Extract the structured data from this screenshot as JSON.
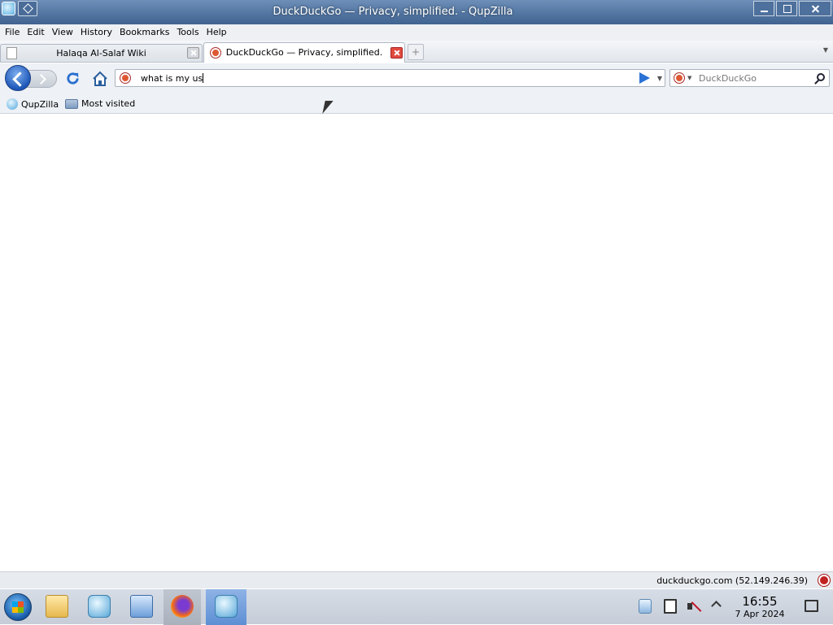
{
  "window": {
    "title": "DuckDuckGo — Privacy, simplified. - QupZilla"
  },
  "menubar": {
    "items": [
      "File",
      "Edit",
      "View",
      "History",
      "Bookmarks",
      "Tools",
      "Help"
    ]
  },
  "tabs": [
    {
      "label": "Halaqa Al-Salaf Wiki",
      "active": false
    },
    {
      "label": "DuckDuckGo — Privacy, simplified.",
      "active": true
    }
  ],
  "navbar": {
    "url_value": "what is my us",
    "search_placeholder": "DuckDuckGo"
  },
  "bookmarks": {
    "items": [
      "QupZilla",
      "Most visited"
    ]
  },
  "statusbar": {
    "text": "duckduckgo.com (52.149.246.39)"
  },
  "taskbar": {
    "apps": [
      "file-manager",
      "qupzilla",
      "system-settings",
      "firefox",
      "qupzilla-active"
    ],
    "clock": {
      "time": "16:55",
      "date": "7 Apr 2024"
    }
  },
  "colors": {
    "ddg": "#de5833",
    "titlebar": "#3f6290",
    "go": "#2a72d4"
  }
}
